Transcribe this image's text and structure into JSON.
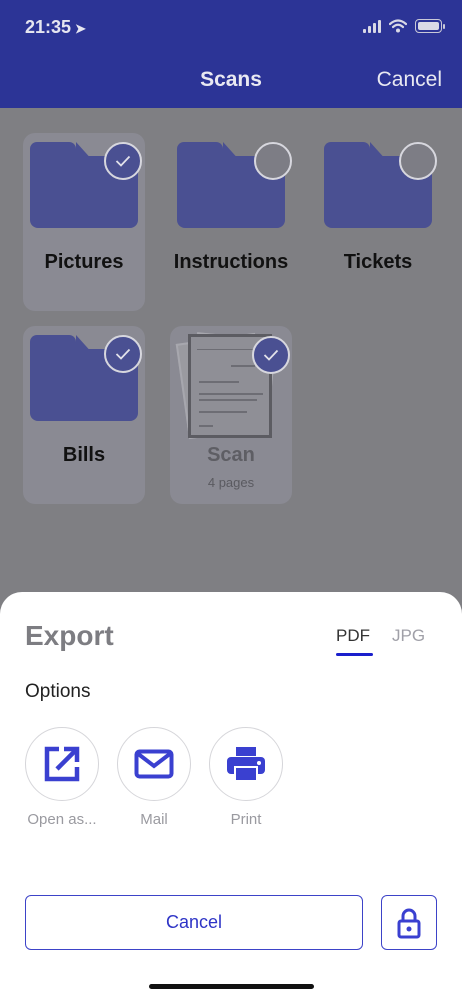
{
  "status": {
    "time": "21:35"
  },
  "nav": {
    "title": "Scans",
    "cancel_label": "Cancel"
  },
  "folders": [
    {
      "name": "Pictures",
      "selected": true
    },
    {
      "name": "Instructions",
      "selected": false
    },
    {
      "name": "Tickets",
      "selected": false
    },
    {
      "name": "Bills",
      "selected": true
    }
  ],
  "scan_doc": {
    "name": "Scan",
    "pages": "4 pages",
    "selected": true
  },
  "sheet": {
    "title": "Export",
    "formats": [
      "PDF",
      "JPG"
    ],
    "selected_format": "PDF",
    "options_label": "Options",
    "options": [
      {
        "label": "Open as...",
        "icon": "external-link-icon"
      },
      {
        "label": "Mail",
        "icon": "mail-icon"
      },
      {
        "label": "Print",
        "icon": "printer-icon"
      }
    ],
    "cancel_label": "Cancel",
    "lock_icon": "lock-icon"
  },
  "colors": {
    "accent": "#3d43c8",
    "folder": "#4a5092",
    "navbar": "#2c3496"
  }
}
